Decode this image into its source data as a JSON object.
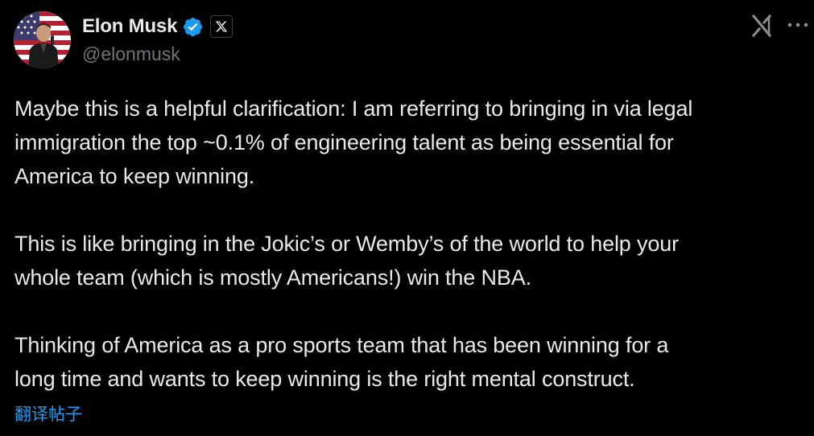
{
  "author": {
    "display_name": "Elon Musk",
    "handle": "@elonmusk",
    "verified": true,
    "affiliation_icon": "x-logo-icon"
  },
  "icons": {
    "grok": "grok-icon",
    "more": "more-horizontal-icon",
    "verified": "verified-badge-icon"
  },
  "colors": {
    "background": "#000000",
    "text": "#e7e9ea",
    "secondary_text": "#71767b",
    "link": "#1d9bf0",
    "verified_badge": "#1d9bf0"
  },
  "tweet": {
    "paragraphs": [
      "Maybe this is a helpful clarification: I am referring to bringing in via legal\nimmigration the top ~0.1% of engineering talent as being essential for\nAmerica to keep winning.",
      "This is like bringing in the Jokic’s or Wemby’s of the world to help your\nwhole team (which is mostly Americans!) win the NBA.",
      "Thinking of America as a pro sports team that has been winning for a\nlong time and wants to keep winning is the right mental construct."
    ],
    "translate_label": "翻译帖子"
  }
}
